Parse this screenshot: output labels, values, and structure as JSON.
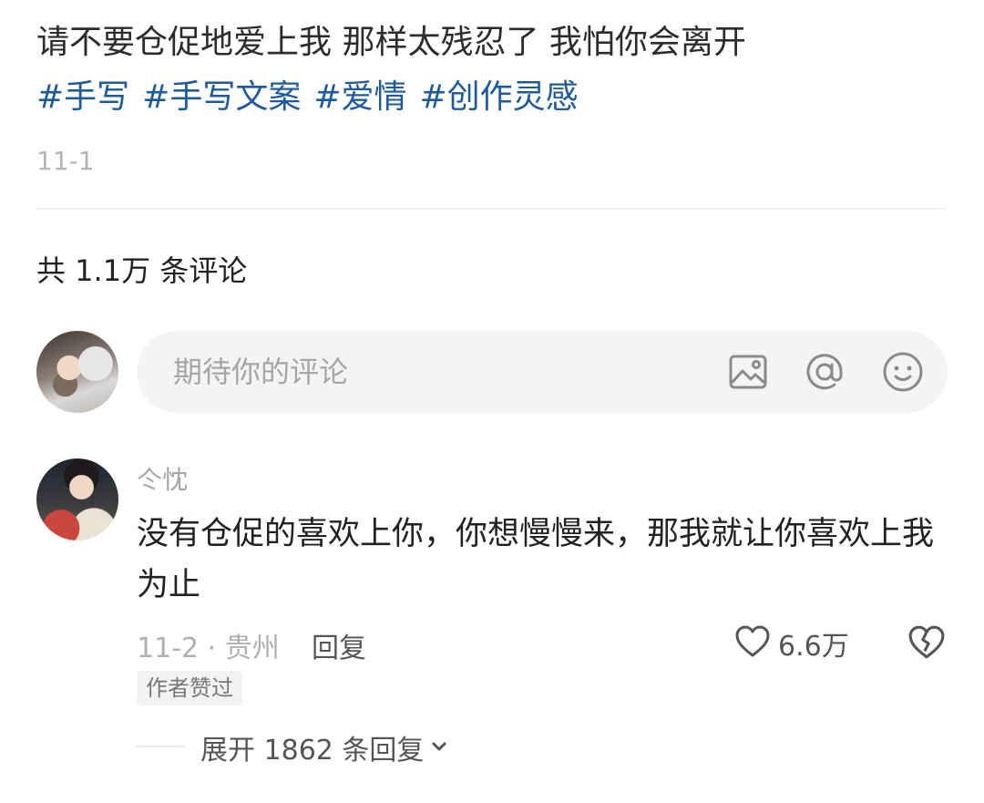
{
  "post": {
    "text": "请不要仓促地爱上我 那样太残忍了 我怕你会离开",
    "tags": [
      "#手写",
      "#手写文案",
      "#爱情",
      "#创作灵感"
    ],
    "date": "11-1"
  },
  "comments_section": {
    "count_label": "共 1.1万 条评论",
    "input_placeholder": "期待你的评论",
    "input_icons": [
      "image-icon",
      "at-icon",
      "emoji-icon"
    ]
  },
  "comment": {
    "author": "仒忱",
    "text": "没有仓促的喜欢上你，你想慢慢来，那我就让你喜欢上我为止",
    "meta": "11-2 · 贵州",
    "reply_label": "回复",
    "like_count": "6.6万",
    "author_badge": "作者赞过",
    "expand_label": "展开 1862 条回复"
  },
  "colors": {
    "tag": "#1f5b9c",
    "muted": "#a6a6a6",
    "input_bg": "#f4f4f4"
  }
}
